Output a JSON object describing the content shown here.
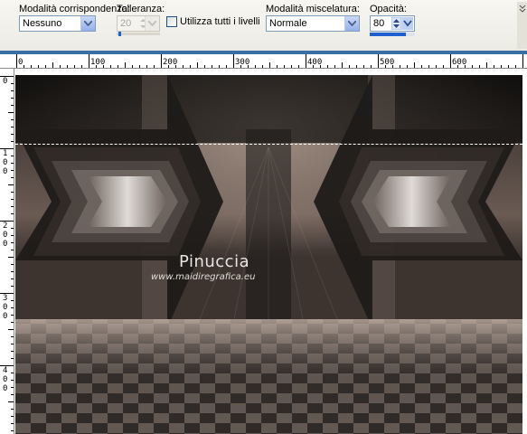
{
  "toolbar": {
    "match_mode_label": "Modalità corrispondenza:",
    "match_mode_value": "Nessuno",
    "tolerance_label": "Tolleranza:",
    "tolerance_value": "20",
    "tolerance_level": 0.05,
    "use_all_layers_label": "Utilizza tutti i livelli",
    "use_all_layers_checked": false,
    "blend_mode_label": "Modalità miscelatura:",
    "blend_mode_value": "Normale",
    "opacity_label": "Opacità:",
    "opacity_value": "80",
    "opacity_level": 0.8
  },
  "ruler": {
    "h_labels": [
      "0",
      "100",
      "200",
      "300",
      "400",
      "500",
      "600"
    ],
    "v_labels": [
      "0",
      "1\n0\n0",
      "2\n0\n0",
      "3\n0\n0",
      "4\n0\n0"
    ]
  },
  "image": {
    "watermark_name": "Pinuccia",
    "watermark_url": "www.maidiregrafica.eu"
  },
  "colors": {
    "accent": "#1e5fd1",
    "ruler_band": "#3a6ea5",
    "toolbar_bg": "#ecebe4"
  },
  "icons": {
    "dropdown": "chevron-down-icon",
    "spinner": "spin-updown-icon"
  }
}
